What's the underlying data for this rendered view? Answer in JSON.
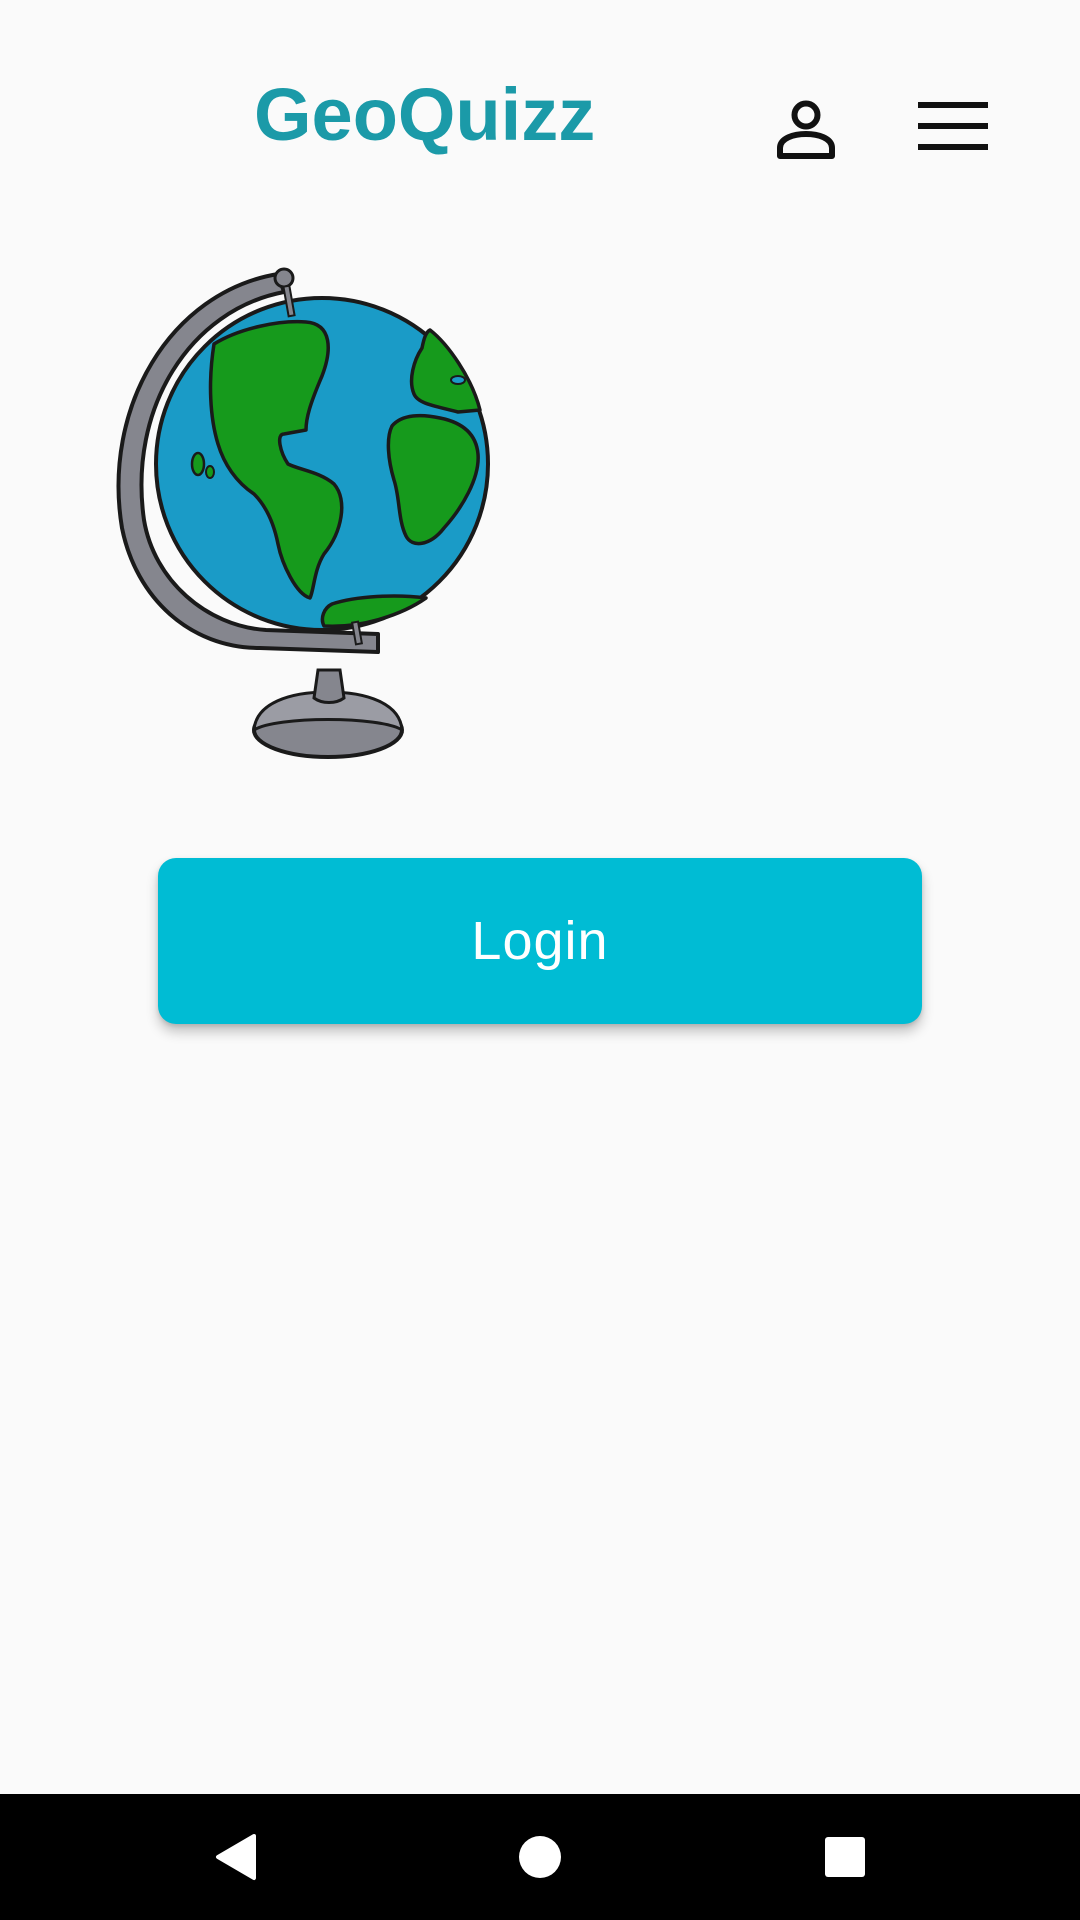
{
  "app": {
    "title": "GeoQuizz"
  },
  "header": {
    "icons": [
      "person-outline-icon",
      "hamburger-menu-icon"
    ]
  },
  "hero": {
    "illustration": "globe-illustration"
  },
  "main": {
    "login_label": "Login"
  },
  "nav_bar": {
    "icons": [
      "back-triangle-icon",
      "home-circle-icon",
      "recents-square-icon"
    ]
  },
  "colors": {
    "title": "#1b9aa8",
    "login_button": "#00bcd4",
    "background": "#fafafa",
    "nav_bar": "#000000",
    "ocean": "#1a9bc7",
    "land": "#169a1c",
    "stand": "#85868e"
  }
}
